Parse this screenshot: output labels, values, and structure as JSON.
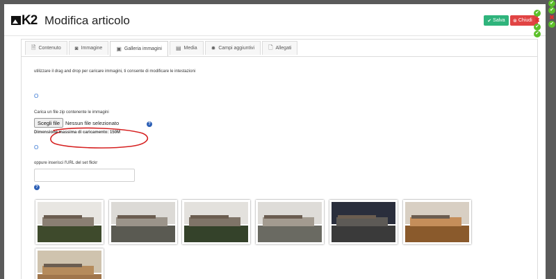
{
  "header": {
    "logo_text": "K2",
    "title": "Modifica articolo",
    "save_label": "Salva",
    "close_label": "Chiudi"
  },
  "tabs": [
    {
      "label": "Contenuto",
      "icon": "document-icon"
    },
    {
      "label": "Immagine",
      "icon": "camera-icon"
    },
    {
      "label": "Galleria immagini",
      "icon": "gallery-icon",
      "active": true
    },
    {
      "label": "Media",
      "icon": "media-icon"
    },
    {
      "label": "Campi aggiuntivi",
      "icon": "gear-icon"
    },
    {
      "label": "Allegati",
      "icon": "attachment-icon"
    }
  ],
  "gallery_pane": {
    "dragdrop_text": "utilizzare il drag and drop per caricare immagini, ti consente di modificare le intestazioni",
    "marker_1": "O",
    "zip_label": "Carica un file zip contenente le immagini",
    "file_button": "Scegli file",
    "file_status": "Nessun file selezionato",
    "max_size": "Dimensione massima di caricamento: 150M",
    "marker_2": "O",
    "flickr_label": "oppure inserisci l'URL del set flickr",
    "flickr_value": "",
    "help_glyph": "?"
  },
  "gallery_images": [
    {
      "name": "facade-day-1",
      "sky": "#e8e6e2",
      "building": "#8a7f73",
      "ground": "#3e4a2c"
    },
    {
      "name": "facade-day-2",
      "sky": "#dcdad6",
      "building": "#9b948a",
      "ground": "#5a5a52"
    },
    {
      "name": "facade-day-3",
      "sky": "#e3e1dd",
      "building": "#7f7468",
      "ground": "#34422a"
    },
    {
      "name": "facade-day-4",
      "sky": "#dedcd8",
      "building": "#a39b90",
      "ground": "#6a6a62"
    },
    {
      "name": "facade-night",
      "sky": "#2a2e3c",
      "building": "#5d5a56",
      "ground": "#3a3a3a"
    },
    {
      "name": "interior-courtyard",
      "sky": "#d8cfc3",
      "building": "#c58e5a",
      "ground": "#8a5a2c"
    },
    {
      "name": "interior-wood",
      "sky": "#cfc3ae",
      "building": "#b58b5c",
      "ground": "#a0764c"
    }
  ],
  "colors": {
    "save": "#2fb47c",
    "close": "#e14444",
    "annotation": "#d62020",
    "link": "#2c6fd0"
  }
}
